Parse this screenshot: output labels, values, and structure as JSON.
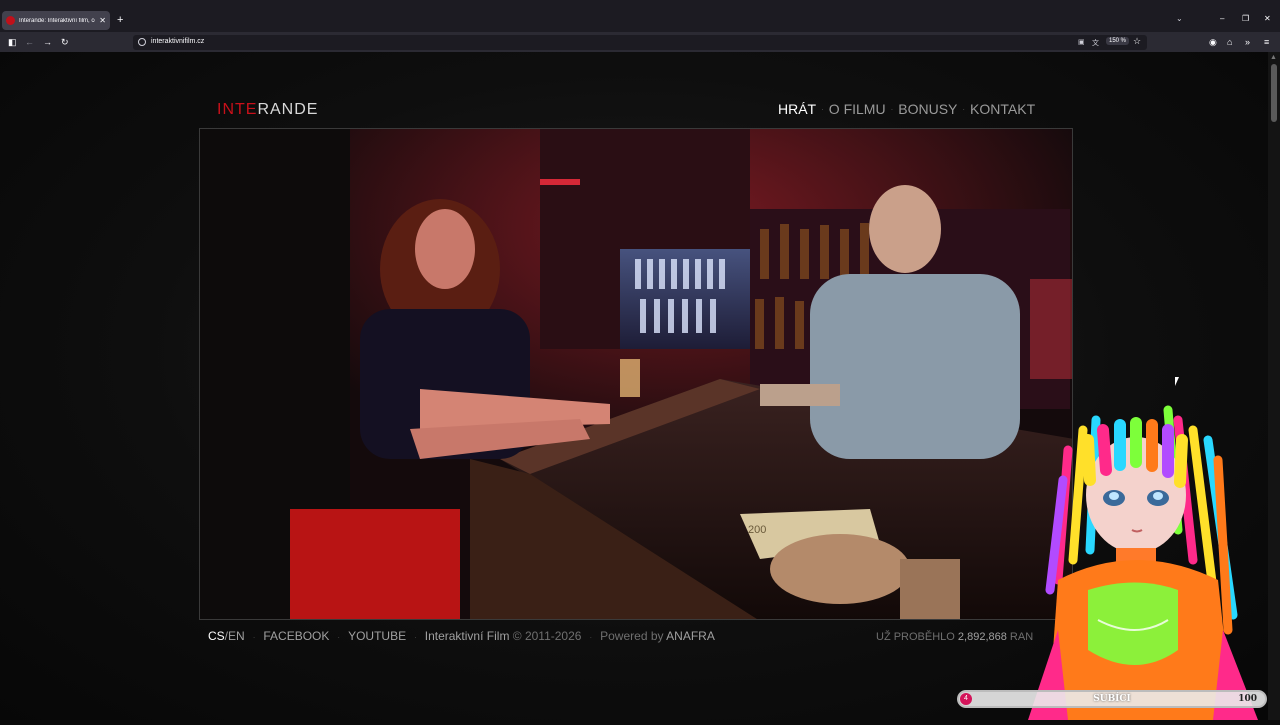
{
  "browser": {
    "tab_title": "Interande: Interaktivní film, co...",
    "new_tab": "+",
    "url": "interaktivnifilm.cz",
    "zoom": "150 %"
  },
  "site": {
    "logo_part1": "INTE",
    "logo_part2": "RANDE",
    "nav": [
      "HRÁT",
      "O FILMU",
      "BONUSY",
      "KONTAKT"
    ],
    "nav_sep": "·",
    "footer": {
      "lang_cs": "CS",
      "lang_en": "/EN",
      "facebook": "FACEBOOK",
      "youtube": "YOUTUBE",
      "brand": "Interaktivní Film",
      "copyright": "© 2011-2026",
      "powered_by": "Powered by",
      "company": "ANAFRA",
      "sep": "·",
      "counter_label": "UŽ PROBĚHLO",
      "counter_value": "2,892,868",
      "counter_suffix": "RAN"
    },
    "banknote": "200"
  },
  "overlay": {
    "sub_label": "SUBÍCI",
    "sub_start": "4",
    "sub_goal": "100"
  },
  "colors": {
    "accent": "#c8101a",
    "page_bg": "#0b0b0b"
  }
}
